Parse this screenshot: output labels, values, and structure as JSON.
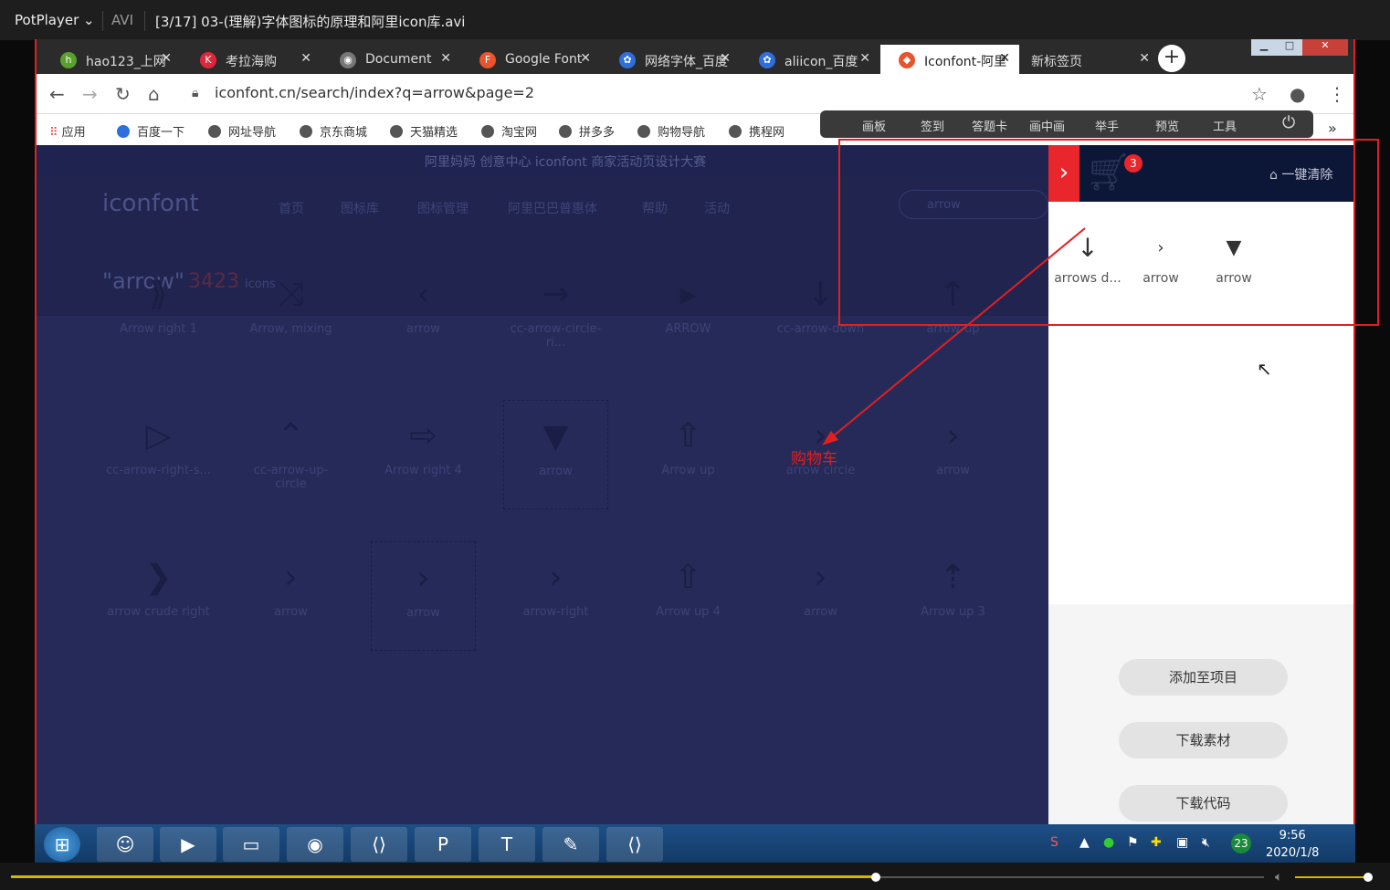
{
  "player": {
    "name": "PotPlayer",
    "format": "AVI",
    "title": "[3/17] 03-(理解)字体图标的原理和阿里icon库.avi"
  },
  "tabs": [
    {
      "label": "hao123_上网",
      "icon": "hao"
    },
    {
      "label": "考拉海购",
      "icon": "K"
    },
    {
      "label": "Document",
      "icon": "globe"
    },
    {
      "label": "Google Font",
      "icon": "F"
    },
    {
      "label": "网络字体_百度",
      "icon": "paw"
    },
    {
      "label": "aliicon_百度",
      "icon": "paw"
    },
    {
      "label": "Iconfont-阿里",
      "icon": "iconfont"
    },
    {
      "label": "新标签页",
      "icon": ""
    }
  ],
  "address": {
    "url": "iconfont.cn/search/index?q=arrow&page=2"
  },
  "bookmarks": [
    "应用",
    "百度一下",
    "网址导航",
    "京东商城",
    "天猫精选",
    "淘宝网",
    "拼多多",
    "购物导航",
    "携程网"
  ],
  "annotation_toolbar": [
    "画板",
    "签到",
    "答题卡",
    "画中画",
    "举手",
    "预览",
    "工具"
  ],
  "page": {
    "topbanner": "阿里妈妈 创意中心 iconfont 商家活动页设计大赛",
    "logo": "iconfont",
    "nav": [
      "首页",
      "图标库",
      "图标管理",
      "阿里巴巴普惠体",
      "帮助",
      "活动"
    ],
    "search": "arrow",
    "result_query": "\"arrow\"",
    "result_count": "3423",
    "result_unit": "icons",
    "rows": [
      [
        "Arrow right 1",
        "Arrow, mixing",
        "arrow",
        "cc-arrow-circle-ri...",
        "ARROW",
        "cc-arrow-down",
        "arrow-up"
      ],
      [
        "cc-arrow-right-s...",
        "cc-arrow-up-circle",
        "Arrow right 4",
        "arrow",
        "Arrow up",
        "arrow circle",
        "arrow"
      ],
      [
        "arrow crude right",
        "arrow",
        "arrow",
        "arrow-right",
        "Arrow up 4",
        "arrow",
        "Arrow up 3"
      ]
    ]
  },
  "cart": {
    "count": "3",
    "clear": "一键清除",
    "items": [
      "arrows d...",
      "arrow",
      "arrow"
    ],
    "buttons": [
      "添加至项目",
      "下载素材",
      "下载代码"
    ]
  },
  "annotation": {
    "label": "购物车"
  },
  "taskbar": {
    "time": "9:56",
    "date": "2020/1/8",
    "badge": "23"
  }
}
